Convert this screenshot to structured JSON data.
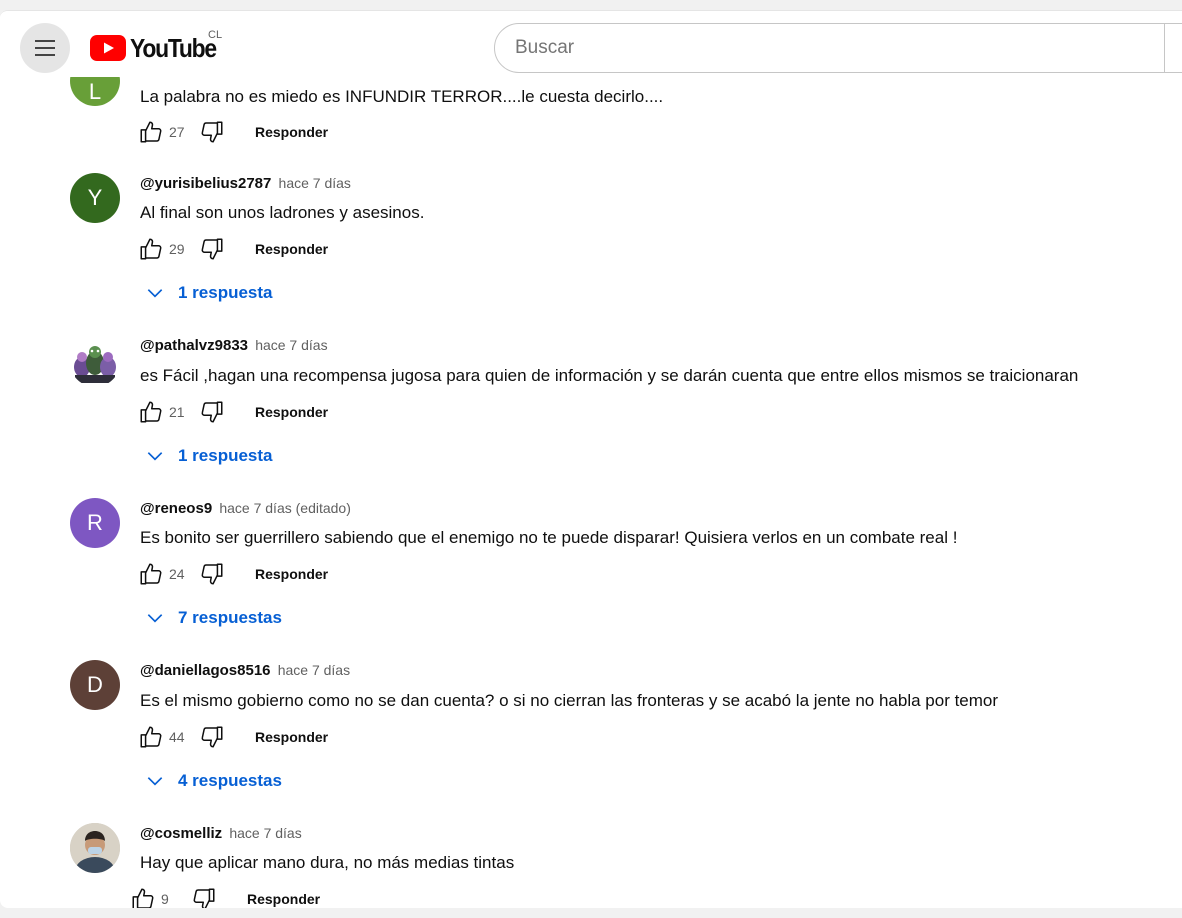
{
  "header": {
    "logo_text": "YouTube",
    "country_code": "CL",
    "search_placeholder": "Buscar"
  },
  "comments": [
    {
      "avatar_letter": "L",
      "avatar_color": "#689f38",
      "text": "La palabra no es miedo es INFUNDIR TERROR....le cuesta decirlo....",
      "likes": "27",
      "reply_label": "Responder"
    },
    {
      "author": "@yurisibelius2787",
      "time": "hace 7 días",
      "avatar_letter": "Y",
      "avatar_color": "#33691e",
      "text": "Al final son unos ladrones y asesinos.",
      "likes": "29",
      "reply_label": "Responder",
      "replies_label": "1 respuesta"
    },
    {
      "author": "@pathalvz9833",
      "time": "hace 7 días",
      "avatar_icon": "cartoon-figures-avatar",
      "text": "es Fácil ,hagan una recompensa jugosa para quien de información y se darán cuenta que entre ellos mismos se traicionaran",
      "likes": "21",
      "reply_label": "Responder",
      "replies_label": "1 respuesta"
    },
    {
      "author": "@reneos9",
      "time": "hace 7 días (editado)",
      "avatar_letter": "R",
      "avatar_color": "#7e57c2",
      "text": "Es bonito ser guerrillero sabiendo que el enemigo no te puede disparar! Quisiera verlos en un combate real !",
      "likes": "24",
      "reply_label": "Responder",
      "replies_label": "7 respuestas"
    },
    {
      "author": "@daniellagos8516",
      "time": "hace 7 días",
      "avatar_letter": "D",
      "avatar_color": "#5d4037",
      "text": "Es el mismo gobierno como no se dan cuenta? o si no cierran las fronteras y se acabó la jente no habla por temor",
      "likes": "44",
      "reply_label": "Responder",
      "replies_label": "4 respuestas"
    },
    {
      "author": "@cosmelliz",
      "time": "hace 7 días",
      "avatar_icon": "person-photo-avatar",
      "text": "Hay que aplicar mano dura, no más medias tintas",
      "likes": "9",
      "reply_label": "Responder"
    }
  ],
  "colors": {
    "link_blue": "#065fd4",
    "youtube_red": "#ff0000",
    "secondary_text": "#606060"
  }
}
